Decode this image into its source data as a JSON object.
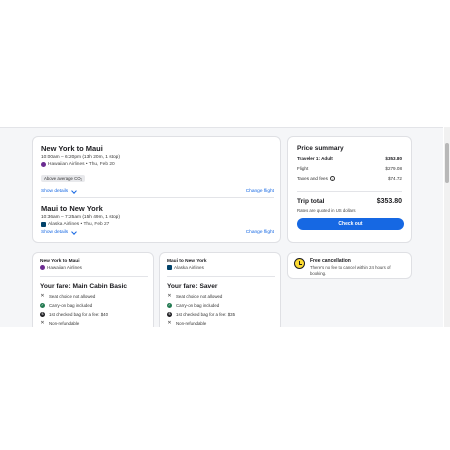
{
  "trips": [
    {
      "title": "New York to Maui",
      "time": "10:00am – 6:20pm (13h 20m, 1 stop)",
      "airline": "Hawaiian Airlines • Thu, Feb 20",
      "badge": "Above average CO₂",
      "show_details": "Show details",
      "change_flight": "Change flight"
    },
    {
      "title": "Maui to New York",
      "time": "10:36am – 7:25am (15h 49m, 1 stop)",
      "airline": "Alaska Airlines • Thu, Feb 27",
      "show_details": "Show details",
      "change_flight": "Change flight"
    }
  ],
  "price_summary": {
    "title": "Price summary",
    "traveler_label": "Traveler 1: Adult",
    "traveler_value": "$353.80",
    "flight_label": "Flight",
    "flight_value": "$279.08",
    "taxes_label": "Taxes and fees",
    "taxes_value": "$74.72",
    "total_label": "Trip total",
    "total_value": "$353.80",
    "rates_note": "Rates are quoted in US dollars",
    "checkout_label": "Check out"
  },
  "fares": [
    {
      "route": "New York to Maui",
      "airline": "Hawaiian Airlines",
      "title": "Your fare: Main Cabin Basic",
      "features": [
        {
          "icon": "x",
          "text": "Seat choice not allowed"
        },
        {
          "icon": "check",
          "text": "Carry-on bag included"
        },
        {
          "icon": "dollar",
          "text": "1st checked bag for a fee: $40"
        },
        {
          "icon": "x",
          "text": "Non-refundable"
        }
      ]
    },
    {
      "route": "Maui to New York",
      "airline": "Alaska Airlines",
      "title": "Your fare: Saver",
      "features": [
        {
          "icon": "x",
          "text": "Seat choice not allowed"
        },
        {
          "icon": "check",
          "text": "Carry-on bag included"
        },
        {
          "icon": "dollar",
          "text": "1st checked bag for a fee: $35"
        },
        {
          "icon": "x",
          "text": "Non-refundable"
        }
      ]
    }
  ],
  "free_cancellation": {
    "title": "Free cancellation",
    "description": "There's no fee to cancel within 24 hours of booking."
  },
  "colors": {
    "accent": "#1668e3",
    "check": "#227950",
    "cancel_icon": "#fddb32"
  }
}
